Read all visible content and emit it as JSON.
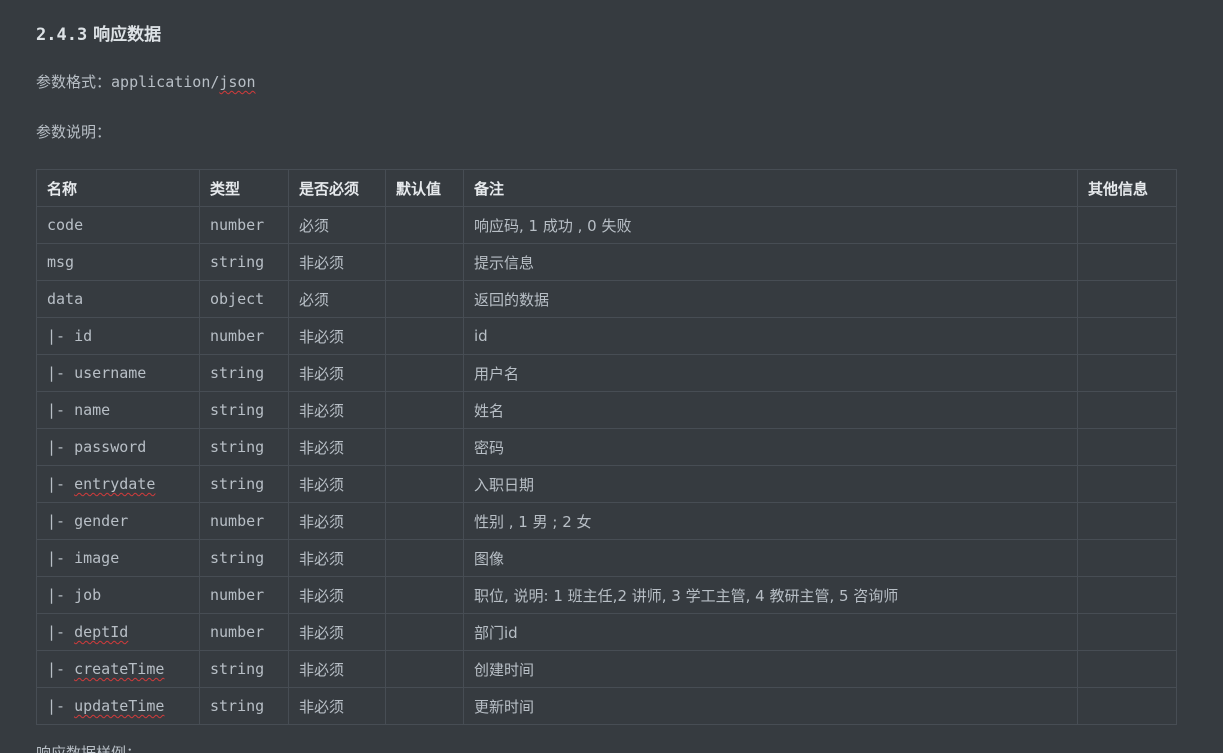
{
  "section": {
    "number": "2.4.3",
    "title": "响应数据"
  },
  "format": {
    "label": "参数格式：",
    "value_prefix": "application/",
    "value_suffix": "json"
  },
  "description_label": "参数说明：",
  "table": {
    "headers": [
      "名称",
      "类型",
      "是否必须",
      "默认值",
      "备注",
      "其他信息"
    ],
    "rows": [
      {
        "prefix": "",
        "name": "code",
        "type": "number",
        "required": "必须",
        "default": "",
        "note": "响应码, 1 成功 , 0 失败",
        "other": ""
      },
      {
        "prefix": "",
        "name": "msg",
        "type": "string",
        "required": "非必须",
        "default": "",
        "note": "提示信息",
        "other": ""
      },
      {
        "prefix": "",
        "name": "data",
        "type": "object",
        "required": "必须",
        "default": "",
        "note": "返回的数据",
        "other": ""
      },
      {
        "prefix": "|- ",
        "name": "id",
        "type": "number",
        "required": "非必须",
        "default": "",
        "note": "id",
        "other": ""
      },
      {
        "prefix": "|- ",
        "name": "username",
        "type": "string",
        "required": "非必须",
        "default": "",
        "note": "用户名",
        "other": ""
      },
      {
        "prefix": "|- ",
        "name": "name",
        "type": "string",
        "required": "非必须",
        "default": "",
        "note": "姓名",
        "other": ""
      },
      {
        "prefix": "|- ",
        "name": "password",
        "type": "string",
        "required": "非必须",
        "default": "",
        "note": "密码",
        "other": ""
      },
      {
        "prefix": "|- ",
        "name": "entrydate",
        "type": "string",
        "required": "非必须",
        "default": "",
        "note": "入职日期",
        "other": ""
      },
      {
        "prefix": "|- ",
        "name": "gender",
        "type": "number",
        "required": "非必须",
        "default": "",
        "note": "性别 , 1 男 ; 2 女",
        "other": ""
      },
      {
        "prefix": "|- ",
        "name": "image",
        "type": "string",
        "required": "非必须",
        "default": "",
        "note": "图像",
        "other": ""
      },
      {
        "prefix": "|- ",
        "name": "job",
        "type": "number",
        "required": "非必须",
        "default": "",
        "note": "职位, 说明: 1 班主任,2 讲师, 3 学工主管, 4 教研主管, 5 咨询师",
        "other": ""
      },
      {
        "prefix": "|- ",
        "name": "deptId",
        "type": "number",
        "required": "非必须",
        "default": "",
        "note": "部门id",
        "other": ""
      },
      {
        "prefix": "|- ",
        "name": "createTime",
        "type": "string",
        "required": "非必须",
        "default": "",
        "note": "创建时间",
        "other": ""
      },
      {
        "prefix": "|- ",
        "name": "updateTime",
        "type": "string",
        "required": "非必须",
        "default": "",
        "note": "更新时间",
        "other": ""
      }
    ]
  },
  "next_label": "响应数据样例："
}
